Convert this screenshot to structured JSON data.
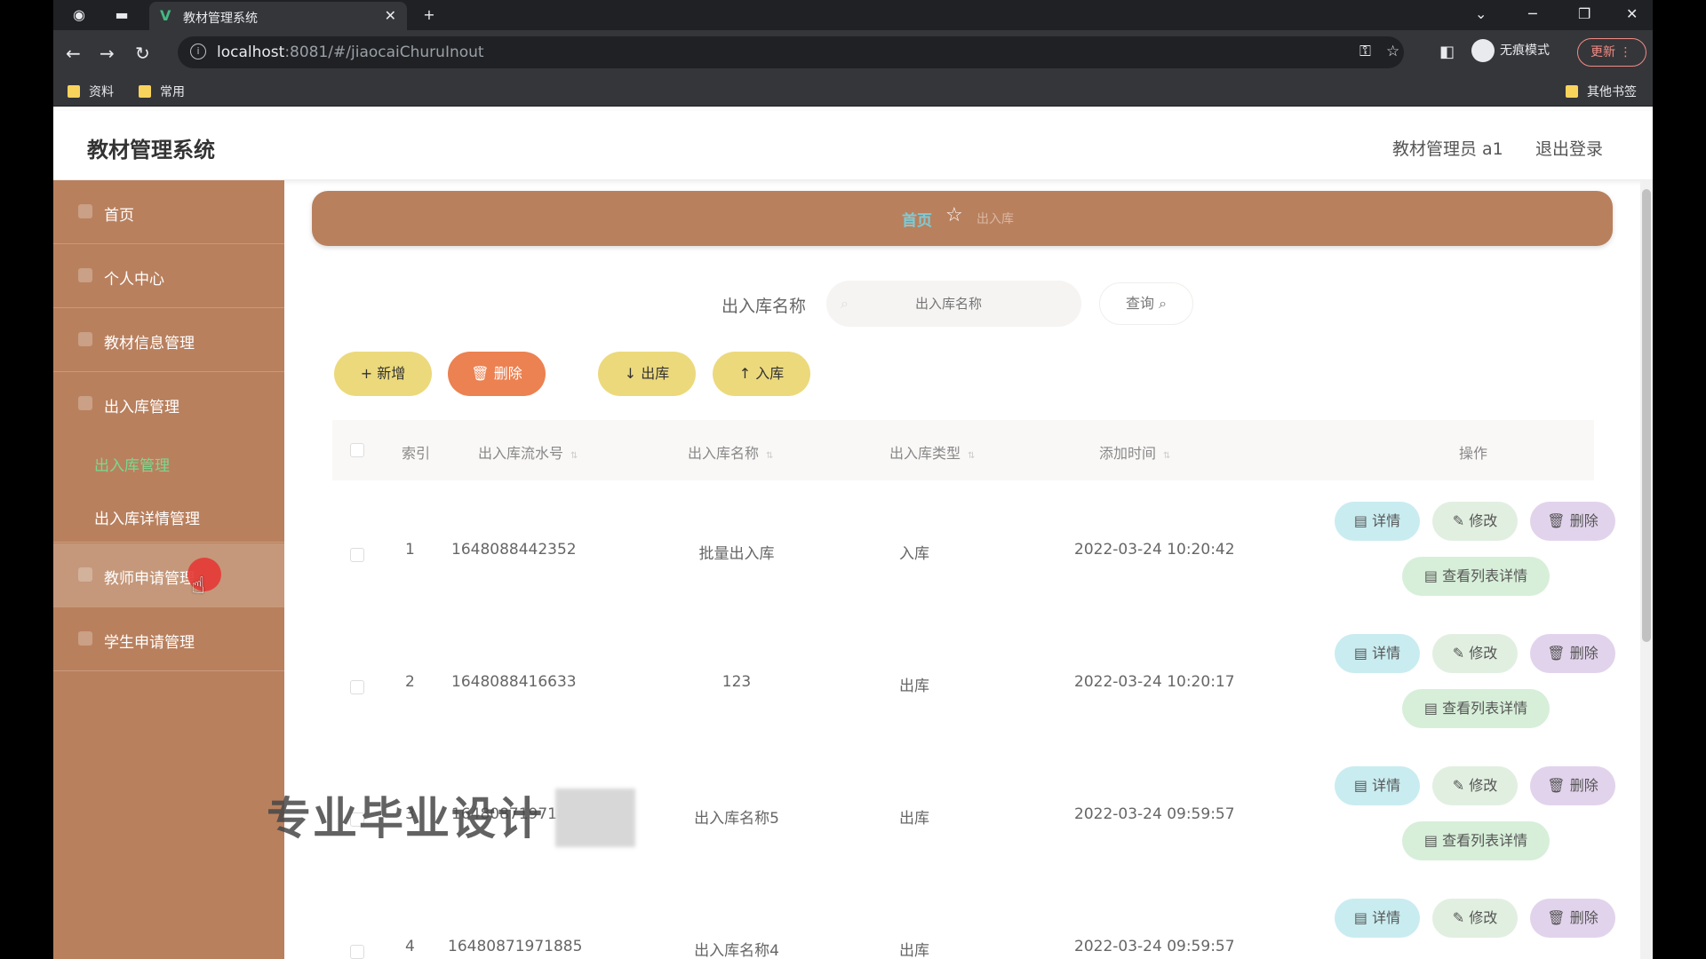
{
  "browser": {
    "tab_title": "教材管理系统",
    "url_host": "localhost",
    "url_rest": ":8081/#/jiaocaiChuruInout",
    "incognito_label": "无痕模式",
    "update_label": "更新",
    "bookmarks": [
      "资料",
      "常用"
    ],
    "other_bookmarks": "其他书签"
  },
  "header": {
    "brand": "教材管理系统",
    "user": "教材管理员 a1",
    "logout": "退出登录"
  },
  "sidebar": {
    "items": [
      {
        "label": "首页"
      },
      {
        "label": "个人中心"
      },
      {
        "label": "教材信息管理"
      },
      {
        "label": "出入库管理"
      },
      {
        "label": "教师申请管理"
      },
      {
        "label": "学生申请管理"
      }
    ],
    "sub_items": [
      {
        "label": "出入库管理"
      },
      {
        "label": "出入库详情管理"
      }
    ]
  },
  "breadcrumb": {
    "home": "首页",
    "current": "出入库"
  },
  "search": {
    "label": "出入库名称",
    "placeholder": "出入库名称",
    "button": "查询"
  },
  "actions": {
    "add": "新增",
    "delete": "删除",
    "out": "出库",
    "in": "入库"
  },
  "table": {
    "columns": [
      "索引",
      "出入库流水号",
      "出入库名称",
      "出入库类型",
      "添加时间",
      "操作"
    ],
    "rows": [
      {
        "index": "1",
        "serial": "1648088442352",
        "name": "批量出入库",
        "type": "入库",
        "time": "2022-03-24 10:20:42"
      },
      {
        "index": "2",
        "serial": "1648088416633",
        "name": "123",
        "type": "出库",
        "time": "2022-03-24 10:20:17"
      },
      {
        "index": "3",
        "serial": "16480871971885",
        "name": "出入库名称5",
        "type": "出库",
        "time": "2022-03-24 09:59:57"
      },
      {
        "index": "4",
        "serial": "16480871971885",
        "name": "出入库名称4",
        "type": "出库",
        "time": "2022-03-24 09:59:57"
      }
    ],
    "row_actions": {
      "detail": "详情",
      "edit": "修改",
      "remove": "删除",
      "list": "查看列表详情"
    }
  },
  "overlay": {
    "watermark": "专业毕业设计"
  }
}
